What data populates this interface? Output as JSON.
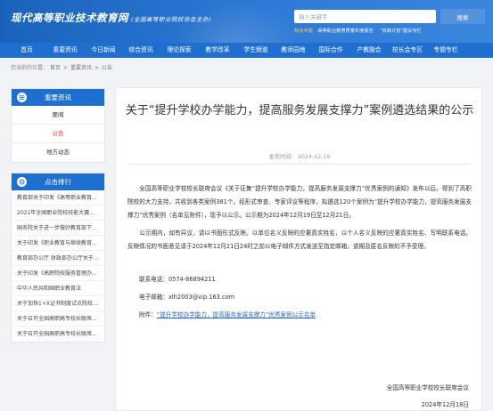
{
  "header": {
    "logo_text": "现代高等职业技术教育网",
    "logo_sub": "(全国高等职业院校协会主办)",
    "search_placeholder": "输入关键字",
    "search_button": "搜索",
    "hot_label": "热点专题",
    "hot_items": [
      "高等职业教育质量年度报告",
      "\"双高计划\"建设专栏"
    ]
  },
  "nav": [
    "首页",
    "重要资讯",
    "今日新闻",
    "综合资讯",
    "理论探索",
    "教学改革",
    "学生频道",
    "教师园地",
    "国际合作",
    "产教融合",
    "校长会专区",
    "专题专栏"
  ],
  "breadcrumb": {
    "label": "您当前的位置：",
    "items": [
      "首页",
      "重要资讯",
      "公告"
    ],
    "separator": ">"
  },
  "sidebar": {
    "section1_title": "重要资讯",
    "section1_items": [
      "要闻",
      "公告",
      "地方动态"
    ],
    "active_item": "公告",
    "section2_title": "点击排行",
    "rank_items": [
      "教育部关于印发《高等职业教育...",
      "2021年全国职业院校技能大赛同...",
      "国务院关于进一步做好教育部下...",
      "关于印发《职业教育与继续教育...",
      "教育部办公厅 财政部办公厅关于...",
      "关于印发《高职院校服务管理办...",
      "中华人民共和国职业教育法",
      "关于加快1+X证书制度试点院校...",
      "关于召开全国高职高专校长联席...",
      "关于召开全国高职高专校长联席..."
    ]
  },
  "article": {
    "title": "关于“提升学校办学能力，提高服务发展支撑力”案例遴选结果的公示",
    "date_label": "发布时间:",
    "date": "2024-12-19",
    "paragraph1": "全国高等职业学校校长联席会议《关于征集“提升学校办学能力，提高服务发展支撑力”优秀案例的通知》发布以后，得到了高职院校的大力支持，共收到各类案例381个。经形式审查、专家评议等程序，拟遴选120个案例为“提升学校办学能力，提高服务发展支撑力”优秀案例（名单见附件），现予以公示。公示期为2024年12月19日至12月21日。",
    "paragraph2": "公示期内，如有异议，请以书面形式反映。以单位名义反映的应署真实姓名，以个人名义反映的应署真实姓名、写明联系电话。反映情况的书面意见请于2024年12月21日24时之前以电子邮件方式发送至指定邮箱，逾期及匿名反映的不予受理。",
    "phone_label": "联系电话：",
    "phone": "0574-86894211",
    "email_label": "电子邮箱：",
    "email": "xlh2003@vip.163.com",
    "attach_label": "附件：",
    "attach_link": "“提升学校办学能力，提高服务发展支撑力”优秀案例公示名单",
    "signature": "全国高等职业学校校长联席会议",
    "sign_date": "2024年12月18日"
  },
  "colors": {
    "header_blue": "#1a63bd",
    "nav_blue": "#1f6fd0",
    "active_red": "#e23b2b",
    "hot_yellow": "#ffd24a",
    "link_blue": "#2a64c5"
  }
}
